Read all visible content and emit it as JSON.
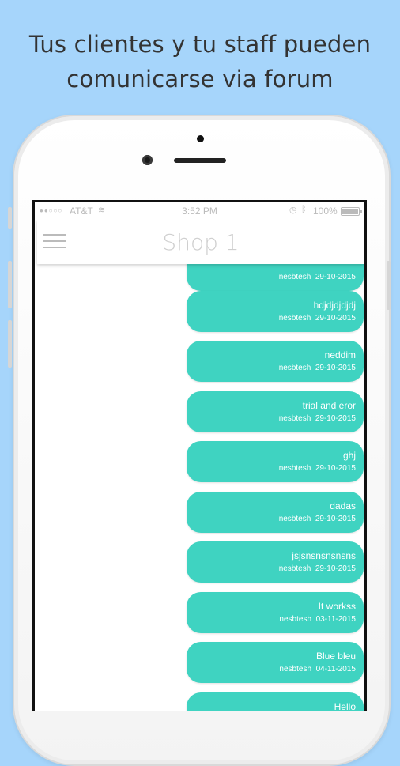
{
  "headline": {
    "line1": "Tus clientes y tu staff pueden",
    "line2": "comunicarse via forum"
  },
  "status_bar": {
    "signal": "●●○○○",
    "carrier": "AT&T",
    "time": "3:52 PM",
    "battery": "100%"
  },
  "nav": {
    "title": "Shop 1"
  },
  "messages": [
    {
      "text": "",
      "author": "nesbtesh",
      "date": "29-10-2015"
    },
    {
      "text": "hdjdjdjdjdj",
      "author": "nesbtesh",
      "date": "29-10-2015"
    },
    {
      "text": "neddim",
      "author": "nesbtesh",
      "date": "29-10-2015"
    },
    {
      "text": "trial and eror",
      "author": "nesbtesh",
      "date": "29-10-2015"
    },
    {
      "text": "ghj",
      "author": "nesbtesh",
      "date": "29-10-2015"
    },
    {
      "text": "dadas",
      "author": "nesbtesh",
      "date": "29-10-2015"
    },
    {
      "text": "jsjsnsnsnsnsns",
      "author": "nesbtesh",
      "date": "29-10-2015"
    },
    {
      "text": "It workss",
      "author": "nesbtesh",
      "date": "03-11-2015"
    },
    {
      "text": "Blue bleu",
      "author": "nesbtesh",
      "date": "04-11-2015"
    },
    {
      "text": "Hello",
      "author": "",
      "date": ""
    }
  ],
  "colors": {
    "background": "#a6d5fb",
    "bubble": "#3fd3c1",
    "headline_text": "#333333"
  },
  "icons": [
    "menu-icon",
    "wifi-icon",
    "alarm-icon",
    "bluetooth-icon",
    "battery-icon"
  ]
}
